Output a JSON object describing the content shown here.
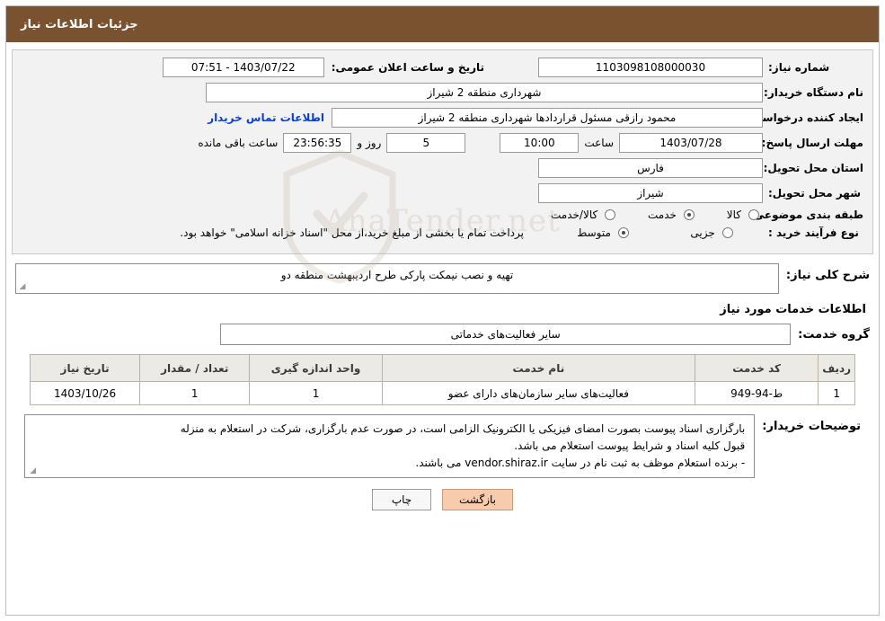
{
  "header": {
    "title": "جزئیات اطلاعات نیاز"
  },
  "info": {
    "need_number_label": "شماره نیاز:",
    "need_number_value": "1103098108000030",
    "public_announce_label": "تاریخ و ساعت اعلان عمومی:",
    "public_announce_value": "1403/07/22 - 07:51",
    "buyer_org_label": "نام دستگاه خریدار:",
    "buyer_org_value": "شهرداری منطقه 2 شیراز",
    "requester_label": "ایجاد کننده درخواست:",
    "requester_value": "محمود رازقی مسئول قراردادها شهرداری منطقه 2 شیراز",
    "contact_link": "اطلاعات تماس خریدار",
    "deadline_label": "مهلت ارسال پاسخ: تا تاریخ:",
    "deadline_date": "1403/07/28",
    "hour_label": "ساعت",
    "deadline_hour": "10:00",
    "days_value": "5",
    "days_label": "روز و",
    "remaining_value": "23:56:35",
    "remaining_label": "ساعت باقی مانده",
    "province_label": "استان محل تحویل:",
    "province_value": "فارس",
    "city_label": "شهر محل تحویل:",
    "city_value": "شیراز",
    "category_label": "طبقه بندی موضوعی:",
    "category_options": [
      {
        "label": "کالا",
        "selected": false
      },
      {
        "label": "خدمت",
        "selected": true
      },
      {
        "label": "کالا/خدمت",
        "selected": false
      }
    ],
    "purchase_type_label": "نوع فرآیند خرید :",
    "purchase_type_options": [
      {
        "label": "جزیی",
        "selected": false
      },
      {
        "label": "متوسط",
        "selected": true
      }
    ],
    "purchase_note": "پرداخت تمام یا بخشی از مبلغ خرید،از محل \"اسناد خزانه اسلامی\" خواهد بود."
  },
  "watermark": {
    "text": "AnaTender.net"
  },
  "body": {
    "general_need_label": "شرح کلی نیاز:",
    "general_need_value": "تهیه و نصب نیمکت پارکی طرح اردیبهشت منطقه دو",
    "services_title": "اطلاعات خدمات مورد نیاز",
    "service_group_label": "گروه خدمت:",
    "service_group_value": "سایر فعالیت‌های خدماتی"
  },
  "table": {
    "headers": [
      "ردیف",
      "کد خدمت",
      "نام خدمت",
      "واحد اندازه گیری",
      "تعداد / مقدار",
      "تاریخ نیاز"
    ],
    "rows": [
      {
        "index": "1",
        "code": "ط-94-949",
        "name": "فعالیت‌های سایر سازمان‌های دارای عضو",
        "unit": "1",
        "qty": "1",
        "date": "1403/10/26"
      }
    ]
  },
  "notes": {
    "label": "توضیحات خریدار:",
    "line1": "بارگزاری اسناد پیوست بصورت امضای فیزیکی یا الکترونیک الزامی است، در صورت عدم بارگزاری، شرکت در استعلام به منزله",
    "line2": "قبول کلیه اسناد و شرایط پیوست استعلام می باشد.",
    "line3": "- برنده استعلام موظف به ثبت نام در سایت vendor.shiraz.ir می باشند."
  },
  "footer": {
    "print_label": "چاپ",
    "back_label": "بازگشت"
  },
  "colors": {
    "header_bg": "#7a5230",
    "accent_button": "#f8cbad",
    "link": "#0b3fd1"
  }
}
